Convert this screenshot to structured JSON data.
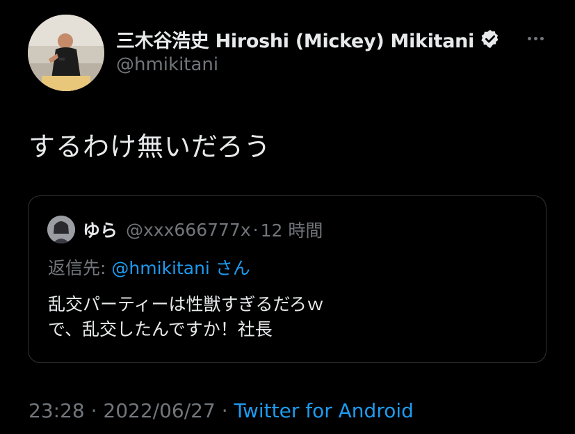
{
  "author": {
    "display_name": "三木谷浩史 Hiroshi (Mickey) Mikitani",
    "handle": "@hmikitani",
    "verified_icon": "verified-badge-icon"
  },
  "more_menu_icon": "more-dots-icon",
  "tweet": {
    "text": "するわけ無いだろう"
  },
  "quoted_tweet": {
    "author_name": "ゆら",
    "author_handle": "@xxx666777x",
    "separator": "·",
    "time": "12 時間",
    "reply_label": "返信先: ",
    "reply_mention": "@hmikitani",
    "reply_suffix": " さん",
    "body_lines": [
      "乱交パーティーは性獣すぎるだろｗ",
      "で、乱交したんですか！社長"
    ]
  },
  "footer": {
    "time": "23:28",
    "sep1": " · ",
    "date": "2022/06/27",
    "sep2": " · ",
    "source": "Twitter for Android"
  },
  "colors": {
    "background": "#000000",
    "text": "#e7e9ea",
    "muted": "#71767b",
    "accent": "#1d9bf0",
    "border": "#2f3336"
  }
}
